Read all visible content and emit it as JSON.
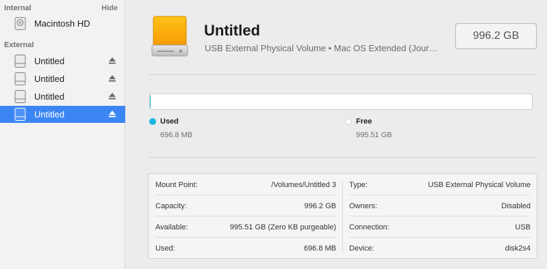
{
  "sidebar": {
    "internal_header": "Internal",
    "hide_label": "Hide",
    "external_header": "External",
    "internal_items": [
      {
        "label": "Macintosh HD",
        "icon": "internal-disk-icon"
      }
    ],
    "external_items": [
      {
        "label": "Untitled",
        "icon": "external-disk-icon",
        "eject": "eject-icon",
        "selected": false
      },
      {
        "label": "Untitled",
        "icon": "external-disk-icon",
        "eject": "eject-icon",
        "selected": false
      },
      {
        "label": "Untitled",
        "icon": "external-disk-icon",
        "eject": "eject-icon",
        "selected": false
      },
      {
        "label": "Untitled",
        "icon": "external-disk-icon",
        "eject": "eject-icon",
        "selected": true
      }
    ]
  },
  "volume": {
    "title": "Untitled",
    "subtitle": "USB External Physical Volume • Mac OS Extended (Jour…",
    "size": "996.2 GB",
    "icon": "orange-external-drive-icon"
  },
  "usage": {
    "used_fraction": 0.0007,
    "used_label": "Used",
    "used_value": "696.8 MB",
    "used_color": "#19b5e4",
    "free_label": "Free",
    "free_value": "995.51 GB",
    "free_color": "#ffffff"
  },
  "info": {
    "left": [
      {
        "key": "Mount Point:",
        "value": "/Volumes/Untitled 3"
      },
      {
        "key": "Capacity:",
        "value": "996.2 GB"
      },
      {
        "key": "Available:",
        "value": "995.51 GB (Zero KB purgeable)"
      },
      {
        "key": "Used:",
        "value": "696.8 MB"
      }
    ],
    "right": [
      {
        "key": "Type:",
        "value": "USB External Physical Volume"
      },
      {
        "key": "Owners:",
        "value": "Disabled"
      },
      {
        "key": "Connection:",
        "value": "USB"
      },
      {
        "key": "Device:",
        "value": "disk2s4"
      }
    ]
  }
}
